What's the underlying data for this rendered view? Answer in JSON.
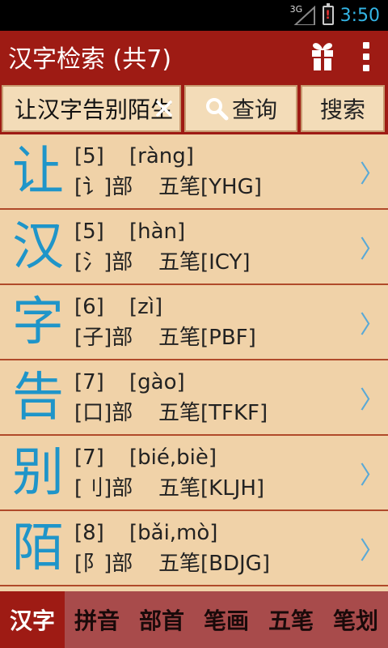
{
  "status_bar": {
    "network": "3G",
    "time": "3:50"
  },
  "title_bar": {
    "title": "汉字检索 (共7)"
  },
  "search": {
    "value": "让汉字告别陌生",
    "query_label": "查询",
    "search_label": "搜索"
  },
  "rows": [
    {
      "char": "让",
      "strokes": "[5]",
      "pinyin": "[ràng]",
      "radical": "[讠]部",
      "wubi": "五笔[YHG]"
    },
    {
      "char": "汉",
      "strokes": "[5]",
      "pinyin": "[hàn]",
      "radical": "[氵]部",
      "wubi": "五笔[ICY]"
    },
    {
      "char": "字",
      "strokes": "[6]",
      "pinyin": "[zì]",
      "radical": "[子]部",
      "wubi": "五笔[PBF]"
    },
    {
      "char": "告",
      "strokes": "[7]",
      "pinyin": "[gào]",
      "radical": "[口]部",
      "wubi": "五笔[TFKF]"
    },
    {
      "char": "别",
      "strokes": "[7]",
      "pinyin": "[bié,biè]",
      "radical": "[刂]部",
      "wubi": "五笔[KLJH]"
    },
    {
      "char": "陌",
      "strokes": "[8]",
      "pinyin": "[bǎi,mò]",
      "radical": "[阝]部",
      "wubi": "五笔[BDJG]"
    }
  ],
  "tabs": [
    "汉字",
    "拼音",
    "部首",
    "笔画",
    "五笔",
    "笔划"
  ],
  "colors": {
    "accent": "#9e1b14",
    "list_bg": "#f0d2a8",
    "char": "#1f95c9",
    "clock": "#33b5e5"
  }
}
